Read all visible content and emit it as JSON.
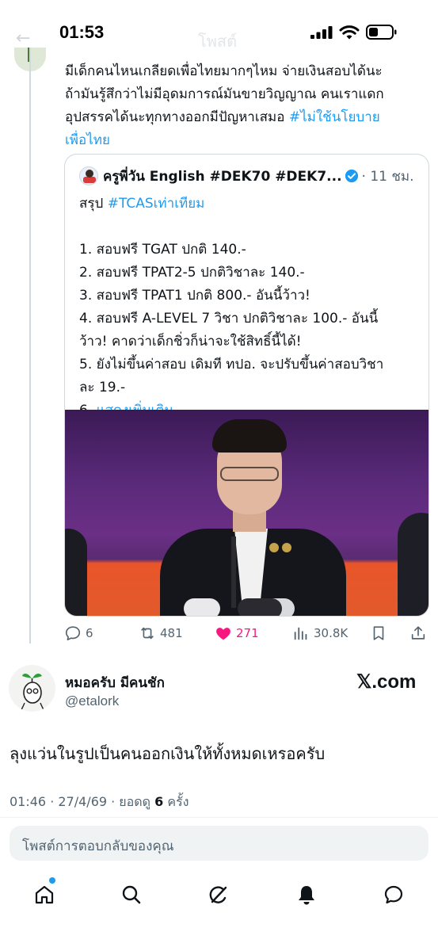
{
  "status_bar": {
    "time": "01:53",
    "faded_back": "←",
    "faded_title": "โพสต์"
  },
  "post": {
    "line1": "มีเด็กคนไหนเกลียดเพื่อไทยมากๆไหม จ่ายเงินสอบได้นะ",
    "line2": "ถ้ามันรู้สึกว่าไม่มีอุดมการณ์มันขายวิญญาณ คนเราแดก",
    "line3": "อุปสรรคได้นะทุกทางออกมีปัญหาเสมอ ",
    "hashtag_part1": "#ไม่ใช้นโยบาย",
    "hashtag_part2": "เพื่อไทย"
  },
  "quote": {
    "author_name": "ครูพี่วัน English #DEK70 #DEK7...",
    "time": "· 11 ชม.",
    "summary_prefix": "สรุป ",
    "summary_hashtag": "#TCASเท่าเทียม",
    "items": [
      "1. สอบฟรี TGAT ปกติ 140.-",
      "2. สอบฟรี TPAT2-5 ปกติวิชาละ 140.-",
      "3. สอบฟรี TPAT1 ปกติ 800.- อันนี้ว้าว!",
      "4. สอบฟรี A-LEVEL 7 วิชา ปกติวิชาละ 100.- อันนี้",
      "ว้าว! คาดว่าเด็กชิ่วก็น่าจะใช้สิทธิ์นี้ได้!",
      "5. ยังไม่ขึ้นค่าสอบ เดิมที ทปอ. จะปรับขึ้นค่าสอบวิชา",
      "ละ 19.-"
    ],
    "item6_prefix": "6. ",
    "show_more": "แสดงเพิ่มเติม"
  },
  "actions": {
    "replies": "6",
    "reposts": "481",
    "likes": "271",
    "views": "30.8K",
    "like_color": "#f91880"
  },
  "reply": {
    "name": "หมอครับ มีคนชัก",
    "handle": "@etalork",
    "watermark": "𝕏.com",
    "text": "ลุงแว่นในรูปเป็นคนออกเงินให้ทั้งหมดเหรอครับ",
    "meta_prefix": "01:46 · 27/4/69 · ยอดดู ",
    "meta_views": "6",
    "meta_suffix": " ครั้ง"
  },
  "compose": {
    "placeholder": "โพสต์การตอบกลับของคุณ"
  },
  "nav": {
    "items": [
      "home-icon",
      "search-icon",
      "grok-icon",
      "notifications-icon",
      "messages-icon"
    ],
    "accent": "#1d9bf0"
  }
}
